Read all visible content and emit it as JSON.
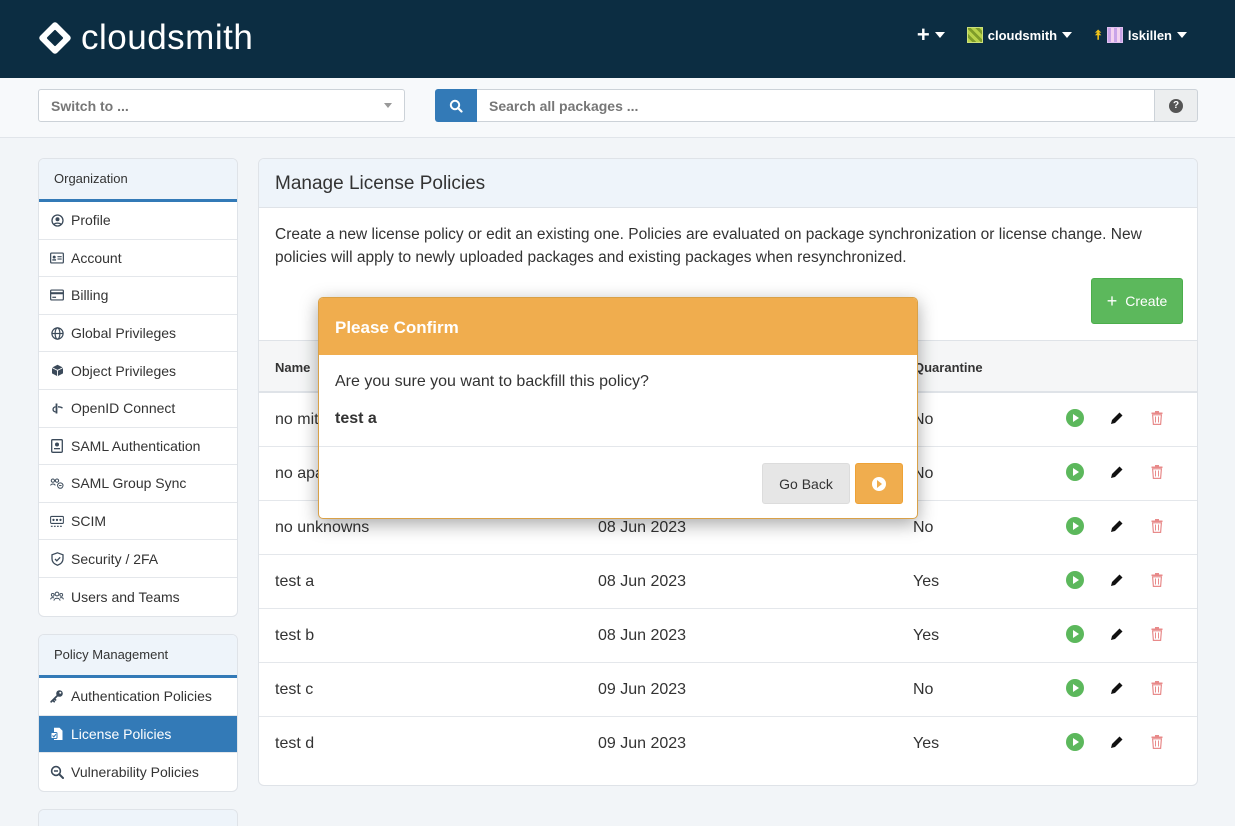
{
  "header": {
    "brand": "cloudsmith",
    "add_icon": "plus-icon",
    "org_menu": "cloudsmith",
    "user_menu": "lskillen"
  },
  "subbar": {
    "switch_placeholder": "Switch to ...",
    "search_placeholder": "Search all packages ...",
    "help_label": "?"
  },
  "sidebar": {
    "organization": {
      "title": "Organization",
      "items": [
        {
          "label": "Profile",
          "icon": "user-circle-icon"
        },
        {
          "label": "Account",
          "icon": "id-card-icon"
        },
        {
          "label": "Billing",
          "icon": "credit-card-icon"
        },
        {
          "label": "Global Privileges",
          "icon": "globe-icon"
        },
        {
          "label": "Object Privileges",
          "icon": "cube-icon"
        },
        {
          "label": "OpenID Connect",
          "icon": "openid-icon"
        },
        {
          "label": "SAML Authentication",
          "icon": "document-badge-icon"
        },
        {
          "label": "SAML Group Sync",
          "icon": "group-sync-icon"
        },
        {
          "label": "SCIM",
          "icon": "scim-icon"
        },
        {
          "label": "Security / 2FA",
          "icon": "shield-icon"
        },
        {
          "label": "Users and Teams",
          "icon": "users-icon"
        }
      ]
    },
    "policy": {
      "title": "Policy Management",
      "items": [
        {
          "label": "Authentication Policies",
          "icon": "key-icon"
        },
        {
          "label": "License Policies",
          "icon": "license-icon",
          "active": true
        },
        {
          "label": "Vulnerability Policies",
          "icon": "magnifier-icon"
        }
      ]
    }
  },
  "main": {
    "title": "Manage License Policies",
    "description": "Create a new license policy or edit an existing one. Policies are evaluated on package synchronization or license change. New policies will apply to newly uploaded packages and existing packages when resynchronized.",
    "create_label": "Create",
    "columns": {
      "name": "Name",
      "quarantine": "Quarantine"
    },
    "rows": [
      {
        "name": "no mit",
        "date": "",
        "quarantine": "No"
      },
      {
        "name": "no apa",
        "date": "",
        "quarantine": "No"
      },
      {
        "name": "no unknowns",
        "date": "08 Jun 2023",
        "quarantine": "No"
      },
      {
        "name": "test a",
        "date": "08 Jun 2023",
        "quarantine": "Yes"
      },
      {
        "name": "test b",
        "date": "08 Jun 2023",
        "quarantine": "Yes"
      },
      {
        "name": "test c",
        "date": "09 Jun 2023",
        "quarantine": "No"
      },
      {
        "name": "test d",
        "date": "09 Jun 2023",
        "quarantine": "Yes"
      }
    ]
  },
  "modal": {
    "title": "Please Confirm",
    "question": "Are you sure you want to backfill this policy?",
    "policy_name": "test a",
    "back_label": "Go Back",
    "confirm_icon": "play-circle-icon"
  },
  "colors": {
    "header_bg": "#0c2d42",
    "primary": "#337ab7",
    "success": "#5cb85c",
    "warning": "#f0ad4e",
    "danger": "#e88a8a"
  }
}
